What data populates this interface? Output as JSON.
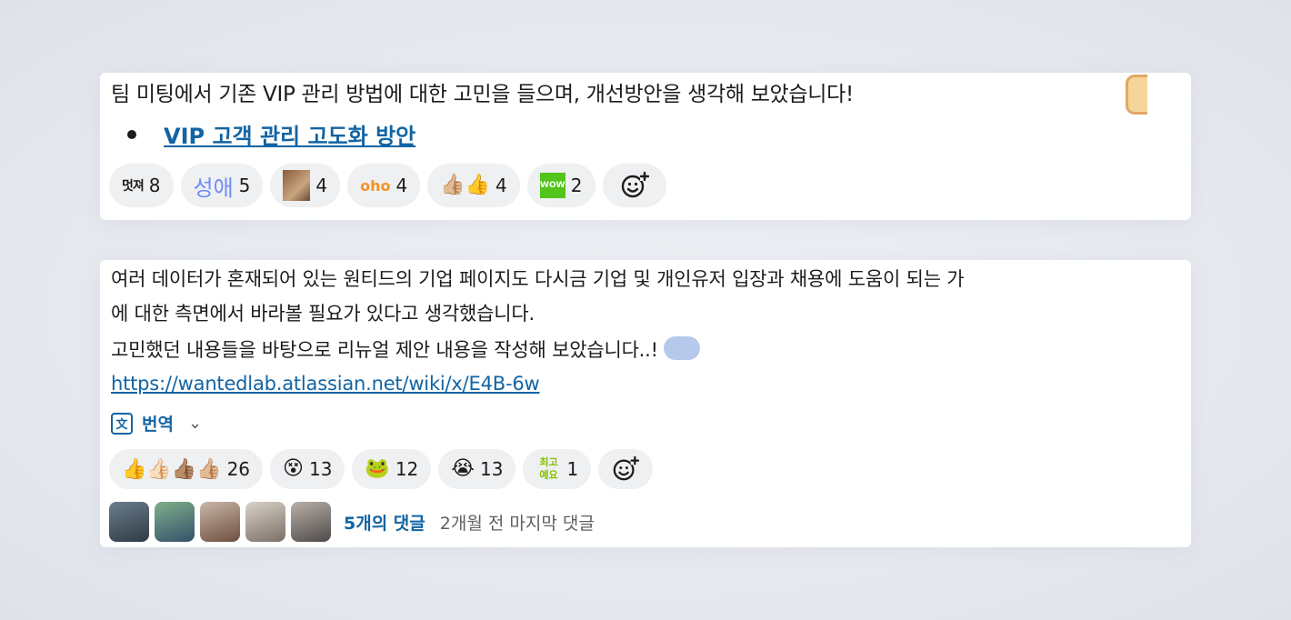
{
  "message1": {
    "text": "팀 미팅에서 기존 VIP 관리 방법에 대한 고민을 들으며, 개선방안을 생각해 보았습니다!",
    "link_text": "VIP 고객 관리 고도화 방안",
    "reactions": [
      {
        "label": "멋져",
        "count": "8"
      },
      {
        "label": "성애",
        "count": "5"
      },
      {
        "label": "",
        "count": "4"
      },
      {
        "label": "oho",
        "count": "4"
      },
      {
        "label": "👍🏼👍",
        "count": "4"
      },
      {
        "label": "WOW",
        "count": "2"
      }
    ]
  },
  "message2": {
    "line1": "여러 데이터가 혼재되어 있는 원티드의 기업 페이지도 다시금 기업 및 개인유저 입장과 채용에 도움이 되는 가",
    "line2": "에 대한 측면에서 바라볼 필요가 있다고 생각했습니다.",
    "line3": "고민했던 내용들을 바탕으로 리뉴얼 제안 내용을 작성해 보았습니다..!",
    "url": "https://wantedlab.atlassian.net/wiki/x/E4B-6w",
    "translate_label": "번역",
    "reactions": [
      {
        "label": "👍👍🏻👍🏽👍🏼",
        "count": "26"
      },
      {
        "label": "😵",
        "count": "13"
      },
      {
        "label": "🐸",
        "count": "12"
      },
      {
        "label": "😭",
        "count": "13"
      },
      {
        "label": "최고예요",
        "count": "1"
      }
    ],
    "thread": {
      "count_label": "5개의 댓글",
      "last_reply": "2개월 전 마지막 댓글"
    }
  },
  "colors": {
    "link": "#1264a3",
    "pill_bg": "#eef0f2"
  }
}
